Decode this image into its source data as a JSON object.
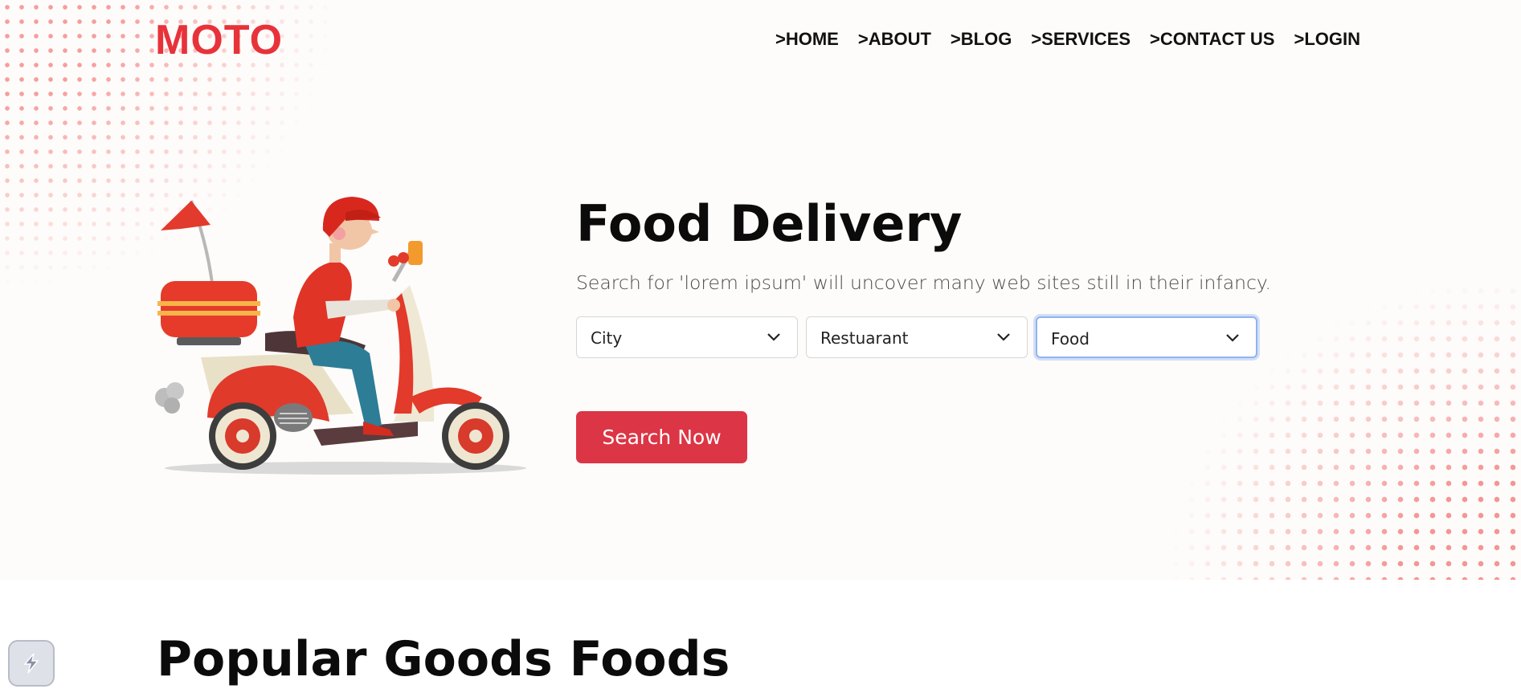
{
  "header": {
    "logo": "MOTO",
    "nav": [
      {
        "label": ">HOME"
      },
      {
        "label": ">ABOUT"
      },
      {
        "label": ">BLOG"
      },
      {
        "label": ">SERVICES"
      },
      {
        "label": ">CONTACT US"
      },
      {
        "label": ">LOGIN"
      }
    ]
  },
  "hero": {
    "title": "Food Delivery",
    "subtitle": "Search for 'lorem ipsum' will uncover many web sites still in their infancy.",
    "selects": [
      {
        "value": "City"
      },
      {
        "value": "Restuarant"
      },
      {
        "value": "Food"
      }
    ],
    "search_button": "Search Now",
    "illustration": "delivery-scooter-rider"
  },
  "section": {
    "title": "Popular Goods Foods"
  },
  "icons": {
    "select": "chevron-down-icon",
    "widget": "bolt-icon"
  },
  "colors": {
    "brand": "#e8323a",
    "button": "#dc3545",
    "background": "#fdfcfa"
  }
}
